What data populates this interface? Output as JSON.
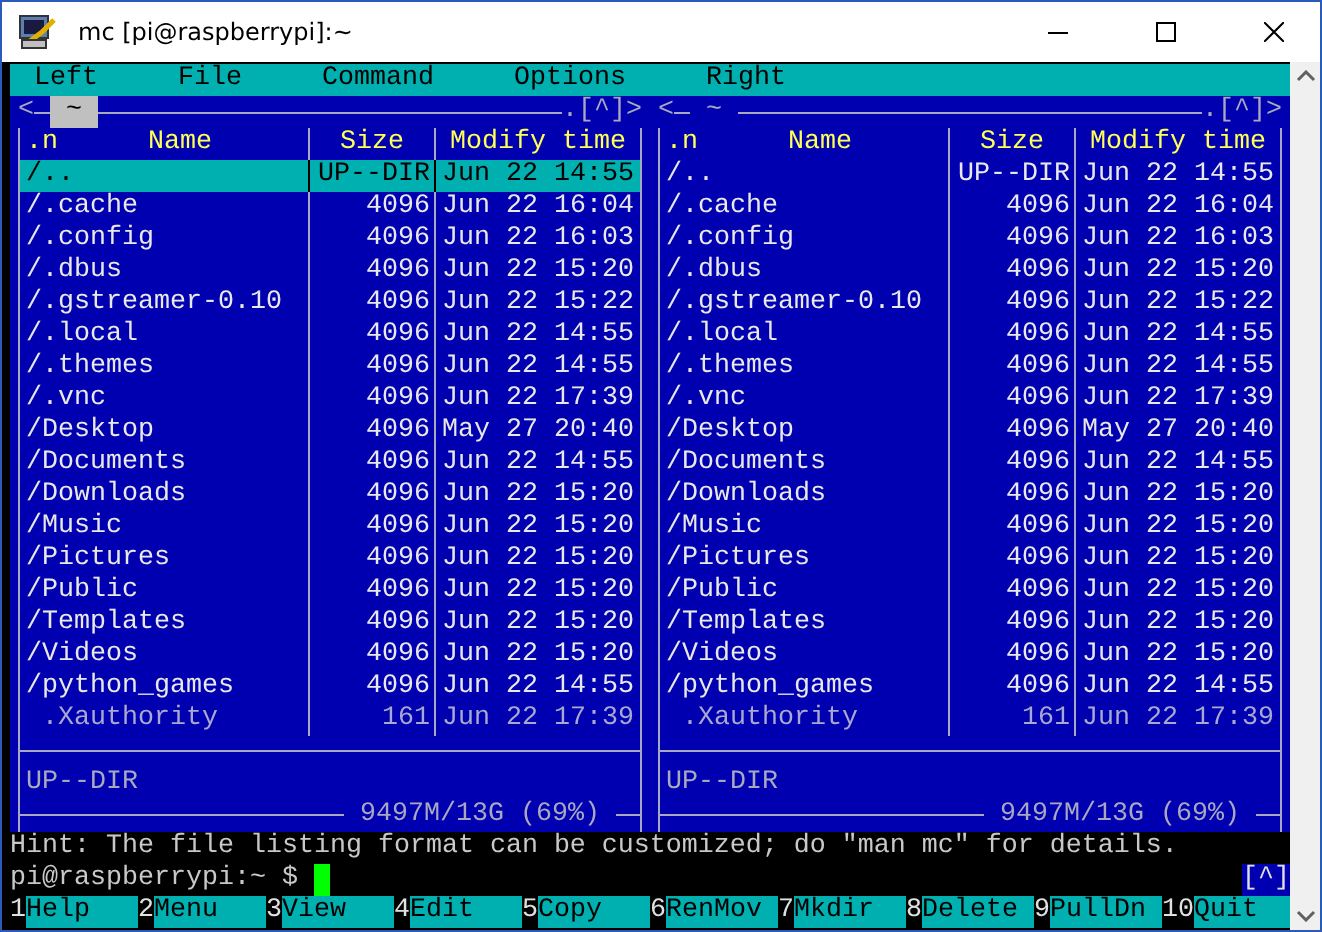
{
  "window": {
    "title": "mc [pi@raspberrypi]:~"
  },
  "menu": [
    "Left",
    "File",
    "Command",
    "Options",
    "Right"
  ],
  "panels": [
    {
      "active": true,
      "nav_left": "<",
      "path": "~",
      "nav_right": ".[^]>",
      "columns": {
        "sort": ".n",
        "name": "Name",
        "size": "Size",
        "time": "Modify time"
      },
      "rows": [
        {
          "name": "/..",
          "size": "UP--DIR",
          "time": "Jun 22 14:55",
          "kind": "dir",
          "selected": true
        },
        {
          "name": "/.cache",
          "size": "4096",
          "time": "Jun 22 16:04",
          "kind": "dir",
          "selected": false
        },
        {
          "name": "/.config",
          "size": "4096",
          "time": "Jun 22 16:03",
          "kind": "dir",
          "selected": false
        },
        {
          "name": "/.dbus",
          "size": "4096",
          "time": "Jun 22 15:20",
          "kind": "dir",
          "selected": false
        },
        {
          "name": "/.gstreamer-0.10",
          "size": "4096",
          "time": "Jun 22 15:22",
          "kind": "dir",
          "selected": false
        },
        {
          "name": "/.local",
          "size": "4096",
          "time": "Jun 22 14:55",
          "kind": "dir",
          "selected": false
        },
        {
          "name": "/.themes",
          "size": "4096",
          "time": "Jun 22 14:55",
          "kind": "dir",
          "selected": false
        },
        {
          "name": "/.vnc",
          "size": "4096",
          "time": "Jun 22 17:39",
          "kind": "dir",
          "selected": false
        },
        {
          "name": "/Desktop",
          "size": "4096",
          "time": "May 27 20:40",
          "kind": "dir",
          "selected": false
        },
        {
          "name": "/Documents",
          "size": "4096",
          "time": "Jun 22 14:55",
          "kind": "dir",
          "selected": false
        },
        {
          "name": "/Downloads",
          "size": "4096",
          "time": "Jun 22 15:20",
          "kind": "dir",
          "selected": false
        },
        {
          "name": "/Music",
          "size": "4096",
          "time": "Jun 22 15:20",
          "kind": "dir",
          "selected": false
        },
        {
          "name": "/Pictures",
          "size": "4096",
          "time": "Jun 22 15:20",
          "kind": "dir",
          "selected": false
        },
        {
          "name": "/Public",
          "size": "4096",
          "time": "Jun 22 15:20",
          "kind": "dir",
          "selected": false
        },
        {
          "name": "/Templates",
          "size": "4096",
          "time": "Jun 22 15:20",
          "kind": "dir",
          "selected": false
        },
        {
          "name": "/Videos",
          "size": "4096",
          "time": "Jun 22 15:20",
          "kind": "dir",
          "selected": false
        },
        {
          "name": "/python_games",
          "size": "4096",
          "time": "Jun 22 14:55",
          "kind": "dir",
          "selected": false
        },
        {
          "name": ".Xauthority",
          "size": "161",
          "time": "Jun 22 17:39",
          "kind": "file",
          "selected": false
        }
      ],
      "mini_status": "UP--DIR",
      "disk": "9497M/13G (69%)"
    },
    {
      "active": false,
      "nav_left": "<",
      "path": "~",
      "nav_right": ".[^]>",
      "columns": {
        "sort": ".n",
        "name": "Name",
        "size": "Size",
        "time": "Modify time"
      },
      "rows": [
        {
          "name": "/..",
          "size": "UP--DIR",
          "time": "Jun 22 14:55",
          "kind": "dir",
          "selected": false
        },
        {
          "name": "/.cache",
          "size": "4096",
          "time": "Jun 22 16:04",
          "kind": "dir",
          "selected": false
        },
        {
          "name": "/.config",
          "size": "4096",
          "time": "Jun 22 16:03",
          "kind": "dir",
          "selected": false
        },
        {
          "name": "/.dbus",
          "size": "4096",
          "time": "Jun 22 15:20",
          "kind": "dir",
          "selected": false
        },
        {
          "name": "/.gstreamer-0.10",
          "size": "4096",
          "time": "Jun 22 15:22",
          "kind": "dir",
          "selected": false
        },
        {
          "name": "/.local",
          "size": "4096",
          "time": "Jun 22 14:55",
          "kind": "dir",
          "selected": false
        },
        {
          "name": "/.themes",
          "size": "4096",
          "time": "Jun 22 14:55",
          "kind": "dir",
          "selected": false
        },
        {
          "name": "/.vnc",
          "size": "4096",
          "time": "Jun 22 17:39",
          "kind": "dir",
          "selected": false
        },
        {
          "name": "/Desktop",
          "size": "4096",
          "time": "May 27 20:40",
          "kind": "dir",
          "selected": false
        },
        {
          "name": "/Documents",
          "size": "4096",
          "time": "Jun 22 14:55",
          "kind": "dir",
          "selected": false
        },
        {
          "name": "/Downloads",
          "size": "4096",
          "time": "Jun 22 15:20",
          "kind": "dir",
          "selected": false
        },
        {
          "name": "/Music",
          "size": "4096",
          "time": "Jun 22 15:20",
          "kind": "dir",
          "selected": false
        },
        {
          "name": "/Pictures",
          "size": "4096",
          "time": "Jun 22 15:20",
          "kind": "dir",
          "selected": false
        },
        {
          "name": "/Public",
          "size": "4096",
          "time": "Jun 22 15:20",
          "kind": "dir",
          "selected": false
        },
        {
          "name": "/Templates",
          "size": "4096",
          "time": "Jun 22 15:20",
          "kind": "dir",
          "selected": false
        },
        {
          "name": "/Videos",
          "size": "4096",
          "time": "Jun 22 15:20",
          "kind": "dir",
          "selected": false
        },
        {
          "name": "/python_games",
          "size": "4096",
          "time": "Jun 22 14:55",
          "kind": "dir",
          "selected": false
        },
        {
          "name": ".Xauthority",
          "size": "161",
          "time": "Jun 22 17:39",
          "kind": "file",
          "selected": false
        }
      ],
      "mini_status": "UP--DIR",
      "disk": "9497M/13G (69%)"
    }
  ],
  "hint": "Hint: The file listing format can be customized; do \"man mc\" for details.",
  "prompt": {
    "text": "pi@raspberrypi:~ $",
    "scroll_marker": "[^]"
  },
  "function_keys": [
    {
      "number": "1",
      "label": "Help"
    },
    {
      "number": "2",
      "label": "Menu"
    },
    {
      "number": "3",
      "label": "View"
    },
    {
      "number": "4",
      "label": "Edit"
    },
    {
      "number": "5",
      "label": "Copy"
    },
    {
      "number": "6",
      "label": "RenMov"
    },
    {
      "number": "7",
      "label": "Mkdir"
    },
    {
      "number": "8",
      "label": "Delete"
    },
    {
      "number": "9",
      "label": "PullDn"
    },
    {
      "number": "10",
      "label": "Quit"
    }
  ]
}
